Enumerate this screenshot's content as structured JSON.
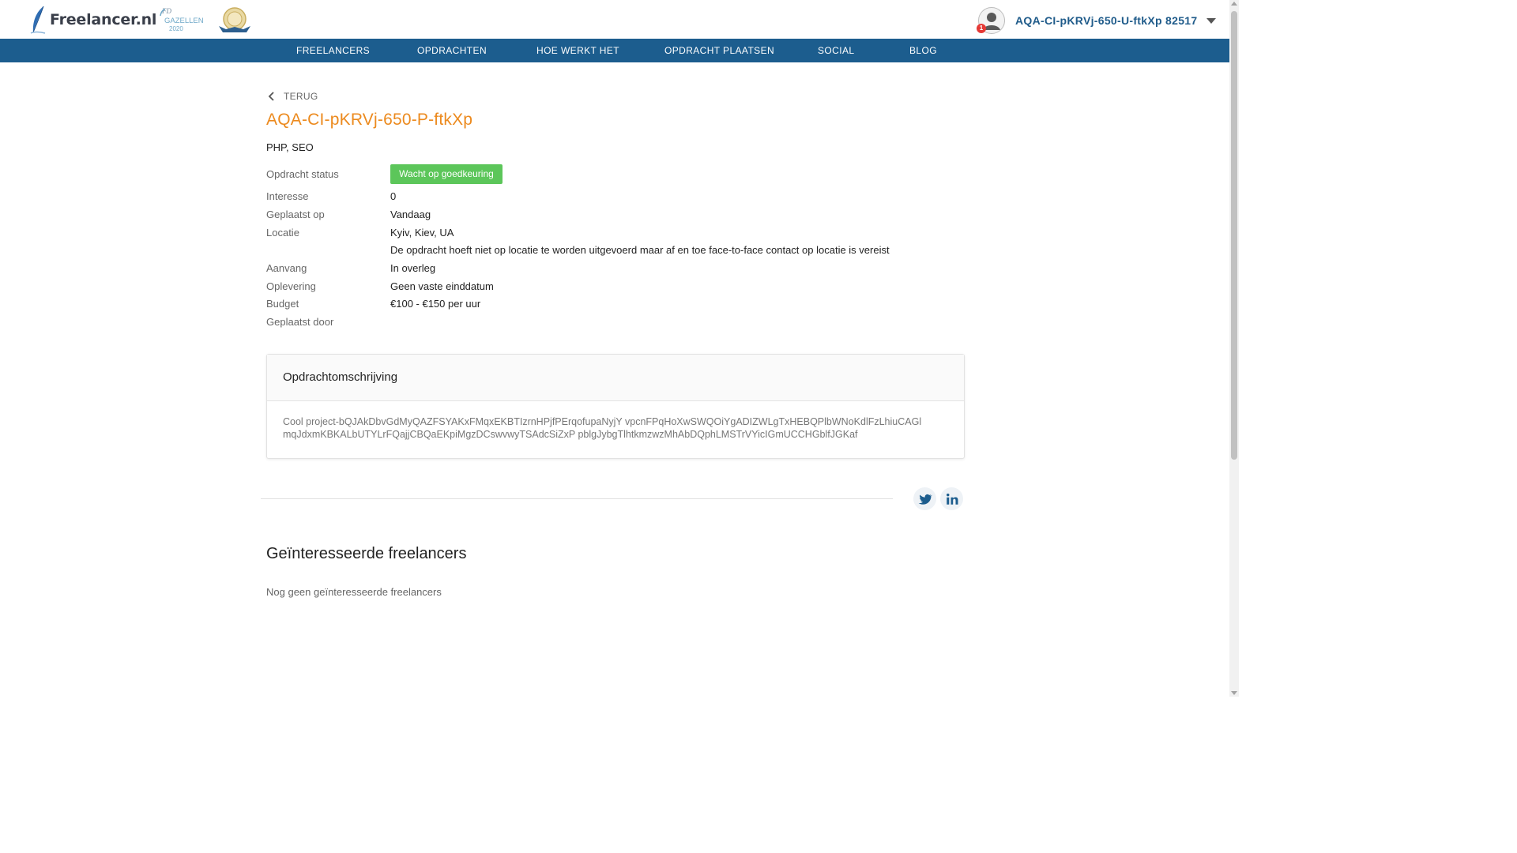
{
  "header": {
    "logo_text": "Freelancer.nl",
    "badge_gazellen": {
      "line1": "FD",
      "line2": "GAZELLEN",
      "year": "2020"
    },
    "user": {
      "name": "AQA-CI-pKRVj-650-U-ftkXp 82517",
      "notifications": "1"
    }
  },
  "nav": {
    "items": [
      {
        "label": "FREELANCERS"
      },
      {
        "label": "OPDRACHTEN"
      },
      {
        "label": "HOE WERKT HET"
      },
      {
        "label": "OPDRACHT PLAATSEN"
      },
      {
        "label": "SOCIAL"
      },
      {
        "label": "BLOG"
      }
    ]
  },
  "page": {
    "back_label": "TERUG",
    "title": "AQA-CI-pKRVj-650-P-ftkXp",
    "skills": "PHP, SEO"
  },
  "details": {
    "status_label": "Opdracht status",
    "status_value": "Wacht op goedkeuring",
    "interest_label": "Interesse",
    "interest_value": "0",
    "placed_label": "Geplaatst op",
    "placed_value": "Vandaag",
    "location_label": "Locatie",
    "location_value": "Kyiv, Kiev, UA",
    "location_note": "De opdracht hoeft niet op locatie te worden uitgevoerd maar af en toe face-to-face contact op locatie is vereist",
    "start_label": "Aanvang",
    "start_value": "In overleg",
    "delivery_label": "Oplevering",
    "delivery_value": "Geen vaste einddatum",
    "budget_label": "Budget",
    "budget_value": "€100 - €150 per uur",
    "placed_by_label": "Geplaatst door",
    "placed_by_value": ""
  },
  "description": {
    "title": "Opdrachtomschrijving",
    "body": "Cool project-bQJAkDbvGdMyQAZFSYAKxFMqxEKBTIzrnHPjfPErqofupaNyjY vpcnFPqHoXwSWQOiYgADIZWLgTxHEBQPlbWNoKdlFzLhiuCAGl mqJdxmKBKALbUTYLrFQajjCBQaEKpiMgzDCswvwyTSAdcSiZxP pblgJybgTlhtkmzwzMhAbDQphLMSTrVYicIGmUCCHGblfJGKaf"
  },
  "interested": {
    "title": "Geïnteresseerde freelancers",
    "empty_text": "Nog geen geïnteresseerde freelancers"
  },
  "colors": {
    "nav_bg": "#1c5d8e",
    "title_orange": "#ec8a1e",
    "status_green": "#5cc65a",
    "username_blue": "#1f5b8a"
  },
  "icons": {
    "back": "chevron-left-icon",
    "twitter": "twitter-icon",
    "linkedin": "linkedin-icon",
    "caret": "caret-down-icon",
    "avatar": "user-avatar-icon"
  }
}
